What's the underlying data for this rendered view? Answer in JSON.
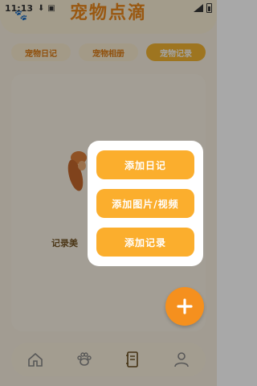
{
  "status_bar": {
    "time": "11:13",
    "icons": [
      "download-icon",
      "app-a-icon"
    ],
    "right_icons": [
      "signal-icon",
      "battery-icon"
    ]
  },
  "header": {
    "title": "宠物点滴",
    "logo_icon": "paw-icon"
  },
  "tabs": [
    {
      "label": "宠物日记",
      "active": false
    },
    {
      "label": "宠物相册",
      "active": false
    },
    {
      "label": "宠物记录",
      "active": true
    }
  ],
  "content": {
    "empty_text": "记录美",
    "illustration": "pet-illustration"
  },
  "popup": {
    "items": [
      {
        "label": "添加日记"
      },
      {
        "label": "添加图片/视频"
      },
      {
        "label": "添加记录"
      }
    ]
  },
  "fab": {
    "icon": "plus-icon",
    "symbol": "+"
  },
  "bottom_nav": [
    {
      "icon": "home-icon"
    },
    {
      "icon": "paw-icon"
    },
    {
      "icon": "notebook-icon",
      "active": true
    },
    {
      "icon": "user-icon"
    }
  ],
  "colors": {
    "accent": "#f5901e",
    "button": "#fbae2d",
    "tab_active": "#f7b733",
    "background": "#fdf5e4"
  }
}
